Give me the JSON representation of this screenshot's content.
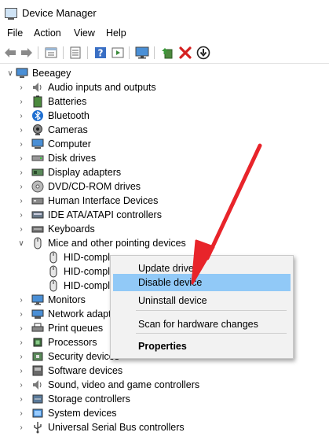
{
  "window": {
    "title": "Device Manager"
  },
  "menu": [
    "File",
    "Action",
    "View",
    "Help"
  ],
  "toolbar": [
    "back-arrow-icon",
    "forward-arrow-icon",
    "properties-icon",
    "list-icon",
    "help-icon",
    "refresh-icon",
    "scan-monitor-icon",
    "update-driver-icon",
    "uninstall-icon",
    "disable-device-icon"
  ],
  "tree": {
    "root": "Beeagey",
    "items": [
      {
        "label": "Audio inputs and outputs",
        "icon": "speaker-icon"
      },
      {
        "label": "Batteries",
        "icon": "battery-icon"
      },
      {
        "label": "Bluetooth",
        "icon": "bluetooth-icon"
      },
      {
        "label": "Cameras",
        "icon": "camera-icon"
      },
      {
        "label": "Computer",
        "icon": "computer-icon"
      },
      {
        "label": "Disk drives",
        "icon": "disk-drive-icon"
      },
      {
        "label": "Display adapters",
        "icon": "display-adapter-icon"
      },
      {
        "label": "DVD/CD-ROM drives",
        "icon": "dvd-drive-icon"
      },
      {
        "label": "Human Interface Devices",
        "icon": "hid-icon"
      },
      {
        "label": "IDE ATA/ATAPI controllers",
        "icon": "ide-controller-icon"
      },
      {
        "label": "Keyboards",
        "icon": "keyboard-icon"
      },
      {
        "label": "Mice and other pointing devices",
        "icon": "mouse-icon",
        "expanded": true
      },
      {
        "label": "HID-compl",
        "icon": "mouse-icon",
        "child": true
      },
      {
        "label": "HID-compl",
        "icon": "mouse-icon",
        "child": true
      },
      {
        "label": "HID-compl",
        "icon": "mouse-icon",
        "child": true
      },
      {
        "label": "Monitors",
        "icon": "monitor-icon"
      },
      {
        "label": "Network adapt",
        "icon": "network-adapter-icon"
      },
      {
        "label": "Print queues",
        "icon": "printer-icon"
      },
      {
        "label": "Processors",
        "icon": "processor-icon"
      },
      {
        "label": "Security devices",
        "icon": "security-device-icon"
      },
      {
        "label": "Software devices",
        "icon": "software-device-icon"
      },
      {
        "label": "Sound, video and game controllers",
        "icon": "sound-icon"
      },
      {
        "label": "Storage controllers",
        "icon": "storage-controller-icon"
      },
      {
        "label": "System devices",
        "icon": "system-device-icon"
      },
      {
        "label": "Universal Serial Bus controllers",
        "icon": "usb-icon"
      }
    ]
  },
  "context_menu": {
    "items": [
      {
        "label": "Update driver",
        "bold": false,
        "highlighted": false
      },
      {
        "label": "Disable device",
        "bold": false,
        "highlighted": true
      },
      {
        "label": "Uninstall device",
        "bold": false,
        "highlighted": false
      },
      {
        "label": "Scan for hardware changes",
        "bold": false,
        "highlighted": false
      },
      {
        "label": "Properties",
        "bold": true,
        "highlighted": false
      }
    ]
  },
  "colors": {
    "highlight": "#91c9f7",
    "arrow": "#e8242a",
    "menu_bg": "#f2f2f2"
  }
}
